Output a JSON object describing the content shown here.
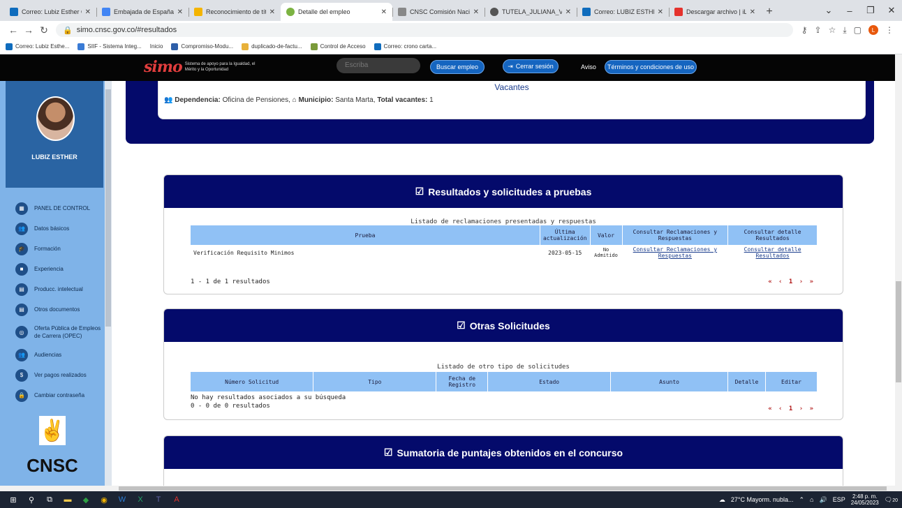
{
  "browser": {
    "tabs": [
      {
        "title": "Correo: Lubiz Esther Ojeda",
        "color": "#0f6cbd"
      },
      {
        "title": "Embajada de España en Co",
        "color": "#4285f4"
      },
      {
        "title": "Reconocimiento de títulos",
        "color": "#f4b400"
      },
      {
        "title": "Detalle del empleo",
        "color": "#7cb342",
        "active": true
      },
      {
        "title": "CNSC Comisión Nacional d",
        "color": "#888888"
      },
      {
        "title": "TUTELA_JULIANA_VALENC",
        "color": "#555555"
      },
      {
        "title": "Correo: LUBIZ ESTHER OJE",
        "color": "#0f6cbd"
      },
      {
        "title": "Descargar archivo | iLoveP",
        "color": "#e5322d"
      }
    ],
    "url": "simo.cnsc.gov.co/#resultados",
    "bookmarks": [
      {
        "label": "Correo: Lubiz Esthe...",
        "color": "#0f6cbd"
      },
      {
        "label": "SIIF - Sistema Integ...",
        "color": "#3a7bd5"
      },
      {
        "label": "Inicio",
        "color": "#ffffff"
      },
      {
        "label": "Compromiso-Modu...",
        "color": "#2e5fa8"
      },
      {
        "label": "duplicado-de-factu...",
        "color": "#e8b13a"
      },
      {
        "label": "Control de Acceso",
        "color": "#7a9a3a"
      },
      {
        "label": "Correo: crono carta...",
        "color": "#0f6cbd"
      }
    ]
  },
  "header": {
    "logo_mark": "simo",
    "logo_text": "Sistema de apoyo para la Igualdad, el Mérito y la Oportunidad",
    "search_placeholder": "Escriba",
    "search_button": "Buscar empleo",
    "logout": "Cerrar sesión",
    "aviso": "Aviso",
    "terms": "Términos y condiciones de uso"
  },
  "sidebar": {
    "user": "LUBIZ ESTHER",
    "items": [
      {
        "label": "PANEL DE CONTROL",
        "icon": "dashboard-icon"
      },
      {
        "label": "Datos básicos",
        "icon": "users-icon"
      },
      {
        "label": "Formación",
        "icon": "graduation-icon"
      },
      {
        "label": "Experiencia",
        "icon": "briefcase-icon"
      },
      {
        "label": "Producc. intelectual",
        "icon": "book-icon"
      },
      {
        "label": "Otros documentos",
        "icon": "document-icon"
      },
      {
        "label": "Oferta Pública de Empleos de Carrera (OPEC)",
        "icon": "globe-icon"
      },
      {
        "label": "Audiencias",
        "icon": "audience-icon"
      },
      {
        "label": "Ver pagos realizados",
        "icon": "dollar-icon"
      },
      {
        "label": "Cambiar contraseña",
        "icon": "lock-icon"
      }
    ],
    "logo_text": "CNSC"
  },
  "vacancy": {
    "title": "Vacantes",
    "dependencia_label": "Dependencia:",
    "dependencia": "Oficina de Pensiones,",
    "municipio_label": "Municipio:",
    "municipio": "Santa Marta,",
    "total_label": "Total vacantes:",
    "total": "1"
  },
  "resultados": {
    "title": "Resultados y solicitudes a pruebas",
    "caption": "Listado de reclamaciones presentadas y respuestas",
    "headers": [
      "Prueba",
      "Última actualización",
      "Valor",
      "Consultar Reclamaciones y Respuestas",
      "Consultar detalle Resultados"
    ],
    "row": {
      "prueba": "Verificación Requisito Minimos",
      "fecha": "2023-05-15",
      "valor": "No Admitido",
      "link1": "Consultar Reclamaciones y Respuestas",
      "link2": "Consultar detalle Resultados"
    },
    "count": "1 - 1 de 1 resultados",
    "pager": "« ‹ 1 › »"
  },
  "otras": {
    "title": "Otras Solicitudes",
    "caption": "Listado de otro tipo de solicitudes",
    "headers": [
      "Número Solicitud",
      "Tipo",
      "Fecha de Registro",
      "Estado",
      "Asunto",
      "Detalle",
      "Editar"
    ],
    "empty": "No hay resultados asociados a su búsqueda",
    "count": "0 - 0 de 0 resultados",
    "pager": "« ‹ 1 › »"
  },
  "sumatoria": {
    "title": "Sumatoria de puntajes obtenidos en el concurso"
  },
  "taskbar": {
    "weather": "27°C Mayorm. nubla...",
    "lang": "ESP",
    "time": "2:48 p. m.",
    "date": "24/05/2023",
    "notif": "20"
  }
}
